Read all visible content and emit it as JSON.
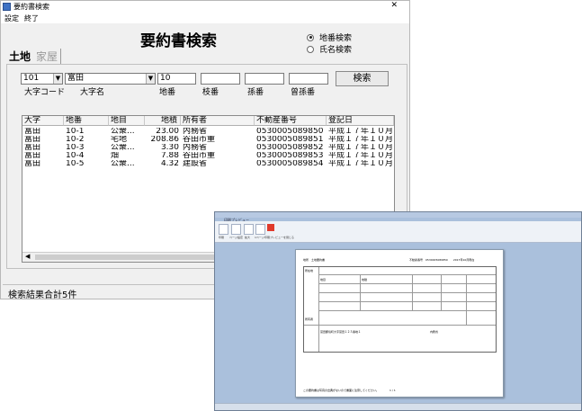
{
  "window": {
    "title": "要約書検索",
    "menu": [
      "設定",
      "終了"
    ]
  },
  "form": {
    "heading": "要約書検索",
    "radio_options": [
      {
        "label": "地番検索",
        "selected": true
      },
      {
        "label": "氏名検索",
        "selected": false
      }
    ],
    "tabs": [
      {
        "label": "土地",
        "active": true
      },
      {
        "label": "家屋",
        "active": false
      }
    ],
    "oaza_code": "101",
    "oaza_name": "富田",
    "chiban": "10",
    "edaban": "",
    "magoban": "",
    "somagoban": "",
    "labels": {
      "oaza_code": "大字コード",
      "oaza_name": "大字名",
      "chiban": "地番",
      "edaban": "枝番",
      "magoban": "孫番",
      "somagoban": "曾孫番"
    },
    "search_button": "検索"
  },
  "results": {
    "columns": [
      "大字",
      "地番",
      "地目",
      "地積",
      "所有者",
      "不動産番号",
      "登記日"
    ],
    "rows": [
      [
        "富田",
        "10-1",
        "公衆...",
        "23.00",
        "内務省",
        "0530005089850",
        "平成１７年１０月"
      ],
      [
        "富田",
        "10-2",
        "宅地",
        "208.86",
        "谷田市重",
        "0530005089851",
        "平成１７年１０月"
      ],
      [
        "富田",
        "10-3",
        "公衆...",
        "3.30",
        "内務省",
        "0530005089852",
        "平成１７年１０月"
      ],
      [
        "富田",
        "10-4",
        "畑",
        "7.88",
        "谷田市重",
        "0530005089853",
        "平成１７年１０月"
      ],
      [
        "富田",
        "10-5",
        "公衆...",
        "4.32",
        "建設省",
        "0530005089854",
        "平成１７年１０月"
      ]
    ]
  },
  "status": {
    "text": "検索結果合計5件"
  },
  "preview": {
    "tab_label": "印刷プレビュー",
    "ribbon_labels": [
      "印刷",
      "ページ設定",
      "拡大",
      "1ページ",
      "印刷プレビューを閉じる"
    ],
    "doc": {
      "header_left": "地所　土地要約書",
      "header_right": "不動産番号　0530005089850　　2017年10月現在",
      "row_labels": [
        "所在地",
        "地目",
        "地積",
        "所有者"
      ],
      "owner_address": "富田郡境町大字富田１２３番地１",
      "owner_name": "内務省",
      "footer_left": "この要約書は写真の出典がないので書面に注意してください。",
      "footer_page": "1 / 1"
    }
  }
}
